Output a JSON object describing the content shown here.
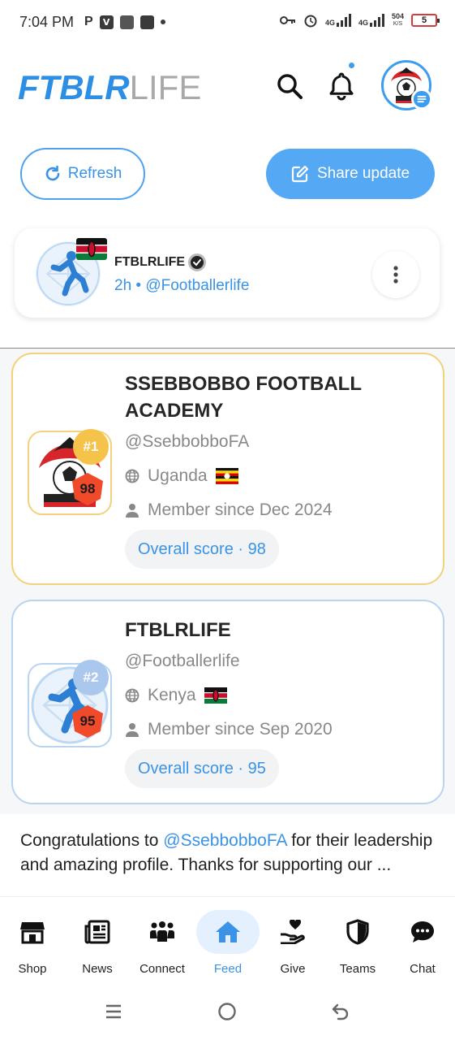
{
  "status_bar": {
    "time": "7:04 PM",
    "left_icons": [
      "P",
      "V"
    ],
    "network_1": "4G",
    "network_2": "4G",
    "speed_value": "504",
    "speed_unit": "K/S",
    "battery": "5"
  },
  "header": {
    "logo_bold": "FTBLR",
    "logo_light": "LIFE",
    "icons": [
      "search-icon",
      "bell-icon",
      "avatar",
      "menu-icon"
    ],
    "accent_color": "#3b9cf0"
  },
  "actions": {
    "refresh_label": "Refresh",
    "share_label": "Share update"
  },
  "post": {
    "author": "FTBLRLIFE",
    "meta": "2h • @Footballerlife"
  },
  "leaderboard": [
    {
      "rank": "#1",
      "score": "98",
      "name_line1": "SSEBBOBBO FOOTBALL",
      "name_line2": "ACADEMY",
      "handle": "@SsebbobboFA",
      "country": "Uganda",
      "member_since": "Member since Dec 2024",
      "overall": "Overall score · 98"
    },
    {
      "rank": "#2",
      "score": "95",
      "name_line1": "FTBLRLIFE",
      "name_line2": "",
      "handle": "@Footballerlife",
      "country": "Kenya",
      "member_since": "Member since Sep 2020",
      "overall": "Overall score · 95"
    }
  ],
  "caption": {
    "before": "Congratulations to ",
    "mention": "@SsebbobboFA",
    "after": " for their leadership and amazing profile. Thanks for supporting our ..."
  },
  "bottom_nav": [
    {
      "label": "Shop"
    },
    {
      "label": "News"
    },
    {
      "label": "Connect"
    },
    {
      "label": "Feed",
      "active": true
    },
    {
      "label": "Give"
    },
    {
      "label": "Teams"
    },
    {
      "label": "Chat"
    }
  ]
}
